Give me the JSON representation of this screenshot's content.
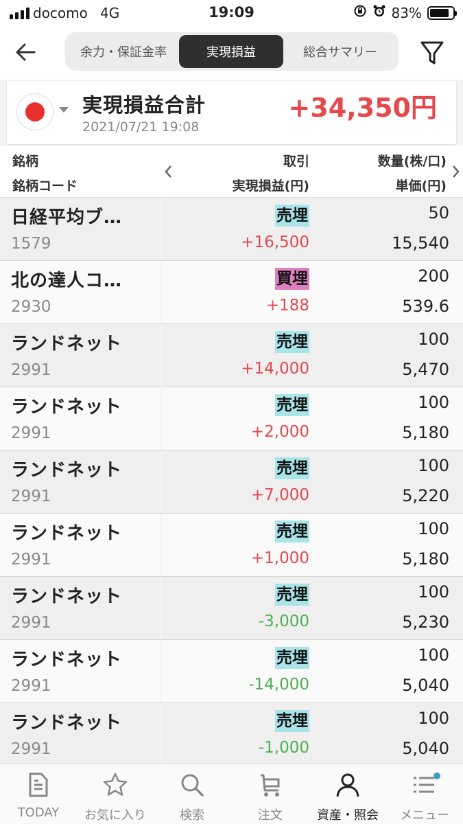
{
  "status": {
    "carrier": "docomo",
    "network": "4G",
    "time": "19:09",
    "battery": "83%",
    "battery_level": 0.83
  },
  "header": {
    "tabs": [
      {
        "label": "余力・保証金率",
        "active": false
      },
      {
        "label": "実現損益",
        "active": true
      },
      {
        "label": "総合サマリー",
        "active": false
      }
    ]
  },
  "summary": {
    "title": "実現損益合計",
    "date": "2021/07/21 19:08",
    "total": "+34,350円"
  },
  "table": {
    "headers": {
      "stock": "銘柄",
      "stock_code": "銘柄コード",
      "trade": "取引",
      "realized_pl": "実現損益(円)",
      "quantity": "数量(株/口)",
      "unit_price": "単価(円)"
    },
    "rows": [
      {
        "name": "日経平均ブ…",
        "code": "1579",
        "type": "売埋",
        "pl": "+16,500",
        "qty": "50",
        "price": "15,540"
      },
      {
        "name": "北の達人コ…",
        "code": "2930",
        "type": "買埋",
        "pl": "+188",
        "qty": "200",
        "price": "539.6"
      },
      {
        "name": "ランドネット",
        "code": "2991",
        "type": "売埋",
        "pl": "+14,000",
        "qty": "100",
        "price": "5,470"
      },
      {
        "name": "ランドネット",
        "code": "2991",
        "type": "売埋",
        "pl": "+2,000",
        "qty": "100",
        "price": "5,180"
      },
      {
        "name": "ランドネット",
        "code": "2991",
        "type": "売埋",
        "pl": "+7,000",
        "qty": "100",
        "price": "5,220"
      },
      {
        "name": "ランドネット",
        "code": "2991",
        "type": "売埋",
        "pl": "+1,000",
        "qty": "100",
        "price": "5,180"
      },
      {
        "name": "ランドネット",
        "code": "2991",
        "type": "売埋",
        "pl": "-3,000",
        "qty": "100",
        "price": "5,230"
      },
      {
        "name": "ランドネット",
        "code": "2991",
        "type": "売埋",
        "pl": "-14,000",
        "qty": "100",
        "price": "5,040"
      },
      {
        "name": "ランドネット",
        "code": "2991",
        "type": "売埋",
        "pl": "-1,000",
        "qty": "100",
        "price": "5,040"
      }
    ]
  },
  "bottom_nav": [
    {
      "label": "TODAY",
      "icon": "document-icon"
    },
    {
      "label": "お気に入り",
      "icon": "star-icon"
    },
    {
      "label": "検索",
      "icon": "search-icon"
    },
    {
      "label": "注文",
      "icon": "cart-icon"
    },
    {
      "label": "資産・照会",
      "icon": "person-icon",
      "active": true
    },
    {
      "label": "メニュー",
      "icon": "menu-icon"
    }
  ],
  "colors": {
    "positive": "#e5484d",
    "negative": "#4caf50",
    "sell_badge": "#a9e4e9",
    "buy_badge": "#dd7fc0",
    "tab_active": "#2f2f2f"
  }
}
